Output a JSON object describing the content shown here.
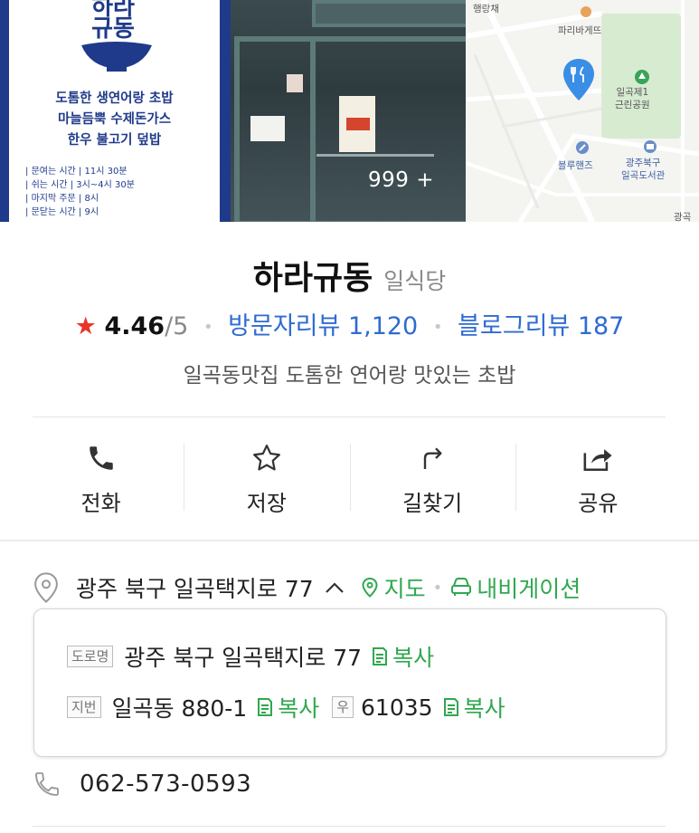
{
  "photos": {
    "sign": {
      "logo_text_line1": "하라",
      "logo_text_line2": "규동",
      "menu": [
        "도톰한 생연어랑 초밥",
        "마늘듬뿍 수제돈가스",
        "한우 불고기 덮밥"
      ],
      "hours": [
        {
          "label": "문여는 시간",
          "value": "11시 30분"
        },
        {
          "label": "쉬는 시간",
          "value": "3시~4시 30분"
        },
        {
          "label": "마지막 주문",
          "value": "8시"
        },
        {
          "label": "문닫는 시간",
          "value": "9시"
        }
      ]
    },
    "photo_count": "999 +",
    "map": {
      "labels": {
        "haengnangchae": "행랑채",
        "paris": "파리바게뜨",
        "park": "일곡제1\n근린공원",
        "bluehands": "블루핸즈",
        "library": "광주북구\n일곡도서관",
        "edge": "광곡"
      }
    }
  },
  "place": {
    "name": "하라규동",
    "category": "일식당",
    "rating": "4.46",
    "rating_max": "/5",
    "visitor_reviews": "방문자리뷰 1,120",
    "blog_reviews": "블로그리뷰 187",
    "description": "일곡동맛집 도톰한 연어랑 맛있는 초밥"
  },
  "actions": {
    "call": "전화",
    "save": "저장",
    "directions": "길찾기",
    "share": "공유"
  },
  "address": {
    "summary": "광주 북구 일곡택지로 77",
    "map_link": "지도",
    "navi_link": "내비게이션",
    "road_tag": "도로명",
    "road": "광주 북구 일곡택지로 77",
    "lot_tag": "지번",
    "lot": "일곡동 880-1",
    "zip_tag": "우",
    "zip": "61035",
    "copy_label": "복사"
  },
  "phone": "062-573-0593",
  "colors": {
    "accent_green": "#2fa84f",
    "link_blue": "#2f6bd1",
    "star_red": "#e8352b",
    "sign_blue": "#1f3a8a"
  }
}
